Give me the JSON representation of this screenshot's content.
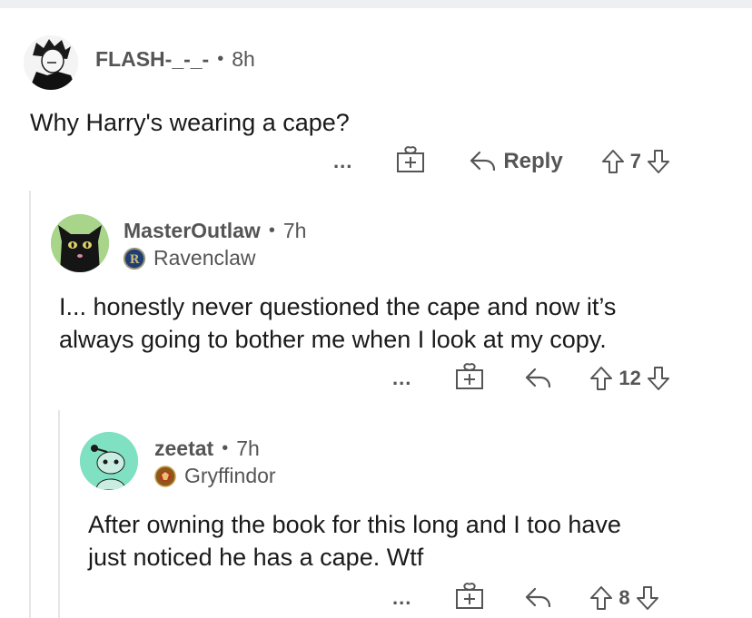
{
  "comments": [
    {
      "username": "FLASH-_-_-",
      "time": "8h",
      "body": "Why Harry's wearing a cape?",
      "more": "...",
      "reply_label": "Reply",
      "votes": "7"
    },
    {
      "username": "MasterOutlaw",
      "time": "7h",
      "flair": "Ravenclaw",
      "body_line1": "I... honestly never questioned the cape and now it’s",
      "body_line2": "always going to bother me when I look at my copy.",
      "more": "...",
      "votes": "12"
    },
    {
      "username": "zeetat",
      "time": "7h",
      "flair": "Gryffindor",
      "body_line1": "After owning the book for this long and I too have",
      "body_line2": "just noticed he has a cape. Wtf",
      "more": "...",
      "votes": "8"
    }
  ],
  "colors": {
    "text": "#1a1a1b",
    "muted": "#555555",
    "thread_line": "#e6e6e6",
    "reddit_teal": "#7fe0c2"
  }
}
